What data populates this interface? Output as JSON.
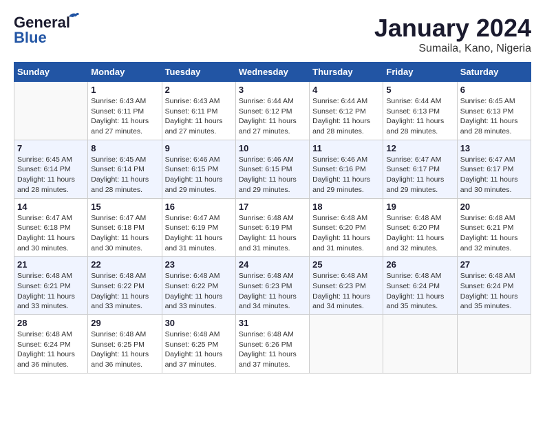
{
  "header": {
    "logo_line1": "General",
    "logo_line2": "Blue",
    "month": "January 2024",
    "location": "Sumaila, Kano, Nigeria"
  },
  "weekdays": [
    "Sunday",
    "Monday",
    "Tuesday",
    "Wednesday",
    "Thursday",
    "Friday",
    "Saturday"
  ],
  "weeks": [
    [
      {
        "day": "",
        "sunrise": "",
        "sunset": "",
        "daylight": ""
      },
      {
        "day": "1",
        "sunrise": "Sunrise: 6:43 AM",
        "sunset": "Sunset: 6:11 PM",
        "daylight": "Daylight: 11 hours and 27 minutes."
      },
      {
        "day": "2",
        "sunrise": "Sunrise: 6:43 AM",
        "sunset": "Sunset: 6:11 PM",
        "daylight": "Daylight: 11 hours and 27 minutes."
      },
      {
        "day": "3",
        "sunrise": "Sunrise: 6:44 AM",
        "sunset": "Sunset: 6:12 PM",
        "daylight": "Daylight: 11 hours and 27 minutes."
      },
      {
        "day": "4",
        "sunrise": "Sunrise: 6:44 AM",
        "sunset": "Sunset: 6:12 PM",
        "daylight": "Daylight: 11 hours and 28 minutes."
      },
      {
        "day": "5",
        "sunrise": "Sunrise: 6:44 AM",
        "sunset": "Sunset: 6:13 PM",
        "daylight": "Daylight: 11 hours and 28 minutes."
      },
      {
        "day": "6",
        "sunrise": "Sunrise: 6:45 AM",
        "sunset": "Sunset: 6:13 PM",
        "daylight": "Daylight: 11 hours and 28 minutes."
      }
    ],
    [
      {
        "day": "7",
        "sunrise": "Sunrise: 6:45 AM",
        "sunset": "Sunset: 6:14 PM",
        "daylight": "Daylight: 11 hours and 28 minutes."
      },
      {
        "day": "8",
        "sunrise": "Sunrise: 6:45 AM",
        "sunset": "Sunset: 6:14 PM",
        "daylight": "Daylight: 11 hours and 28 minutes."
      },
      {
        "day": "9",
        "sunrise": "Sunrise: 6:46 AM",
        "sunset": "Sunset: 6:15 PM",
        "daylight": "Daylight: 11 hours and 29 minutes."
      },
      {
        "day": "10",
        "sunrise": "Sunrise: 6:46 AM",
        "sunset": "Sunset: 6:15 PM",
        "daylight": "Daylight: 11 hours and 29 minutes."
      },
      {
        "day": "11",
        "sunrise": "Sunrise: 6:46 AM",
        "sunset": "Sunset: 6:16 PM",
        "daylight": "Daylight: 11 hours and 29 minutes."
      },
      {
        "day": "12",
        "sunrise": "Sunrise: 6:47 AM",
        "sunset": "Sunset: 6:17 PM",
        "daylight": "Daylight: 11 hours and 29 minutes."
      },
      {
        "day": "13",
        "sunrise": "Sunrise: 6:47 AM",
        "sunset": "Sunset: 6:17 PM",
        "daylight": "Daylight: 11 hours and 30 minutes."
      }
    ],
    [
      {
        "day": "14",
        "sunrise": "Sunrise: 6:47 AM",
        "sunset": "Sunset: 6:18 PM",
        "daylight": "Daylight: 11 hours and 30 minutes."
      },
      {
        "day": "15",
        "sunrise": "Sunrise: 6:47 AM",
        "sunset": "Sunset: 6:18 PM",
        "daylight": "Daylight: 11 hours and 30 minutes."
      },
      {
        "day": "16",
        "sunrise": "Sunrise: 6:47 AM",
        "sunset": "Sunset: 6:19 PM",
        "daylight": "Daylight: 11 hours and 31 minutes."
      },
      {
        "day": "17",
        "sunrise": "Sunrise: 6:48 AM",
        "sunset": "Sunset: 6:19 PM",
        "daylight": "Daylight: 11 hours and 31 minutes."
      },
      {
        "day": "18",
        "sunrise": "Sunrise: 6:48 AM",
        "sunset": "Sunset: 6:20 PM",
        "daylight": "Daylight: 11 hours and 31 minutes."
      },
      {
        "day": "19",
        "sunrise": "Sunrise: 6:48 AM",
        "sunset": "Sunset: 6:20 PM",
        "daylight": "Daylight: 11 hours and 32 minutes."
      },
      {
        "day": "20",
        "sunrise": "Sunrise: 6:48 AM",
        "sunset": "Sunset: 6:21 PM",
        "daylight": "Daylight: 11 hours and 32 minutes."
      }
    ],
    [
      {
        "day": "21",
        "sunrise": "Sunrise: 6:48 AM",
        "sunset": "Sunset: 6:21 PM",
        "daylight": "Daylight: 11 hours and 33 minutes."
      },
      {
        "day": "22",
        "sunrise": "Sunrise: 6:48 AM",
        "sunset": "Sunset: 6:22 PM",
        "daylight": "Daylight: 11 hours and 33 minutes."
      },
      {
        "day": "23",
        "sunrise": "Sunrise: 6:48 AM",
        "sunset": "Sunset: 6:22 PM",
        "daylight": "Daylight: 11 hours and 33 minutes."
      },
      {
        "day": "24",
        "sunrise": "Sunrise: 6:48 AM",
        "sunset": "Sunset: 6:23 PM",
        "daylight": "Daylight: 11 hours and 34 minutes."
      },
      {
        "day": "25",
        "sunrise": "Sunrise: 6:48 AM",
        "sunset": "Sunset: 6:23 PM",
        "daylight": "Daylight: 11 hours and 34 minutes."
      },
      {
        "day": "26",
        "sunrise": "Sunrise: 6:48 AM",
        "sunset": "Sunset: 6:24 PM",
        "daylight": "Daylight: 11 hours and 35 minutes."
      },
      {
        "day": "27",
        "sunrise": "Sunrise: 6:48 AM",
        "sunset": "Sunset: 6:24 PM",
        "daylight": "Daylight: 11 hours and 35 minutes."
      }
    ],
    [
      {
        "day": "28",
        "sunrise": "Sunrise: 6:48 AM",
        "sunset": "Sunset: 6:24 PM",
        "daylight": "Daylight: 11 hours and 36 minutes."
      },
      {
        "day": "29",
        "sunrise": "Sunrise: 6:48 AM",
        "sunset": "Sunset: 6:25 PM",
        "daylight": "Daylight: 11 hours and 36 minutes."
      },
      {
        "day": "30",
        "sunrise": "Sunrise: 6:48 AM",
        "sunset": "Sunset: 6:25 PM",
        "daylight": "Daylight: 11 hours and 37 minutes."
      },
      {
        "day": "31",
        "sunrise": "Sunrise: 6:48 AM",
        "sunset": "Sunset: 6:26 PM",
        "daylight": "Daylight: 11 hours and 37 minutes."
      },
      {
        "day": "",
        "sunrise": "",
        "sunset": "",
        "daylight": ""
      },
      {
        "day": "",
        "sunrise": "",
        "sunset": "",
        "daylight": ""
      },
      {
        "day": "",
        "sunrise": "",
        "sunset": "",
        "daylight": ""
      }
    ]
  ]
}
